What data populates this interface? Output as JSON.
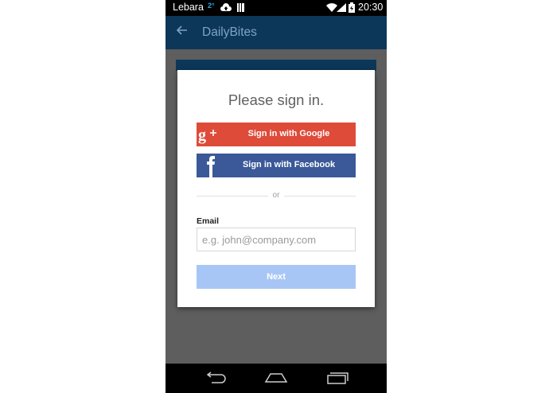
{
  "status_bar": {
    "carrier": "Lebara",
    "temperature": "2°",
    "time": "20:30"
  },
  "app_bar": {
    "title": "DailyBites",
    "back_icon": "arrow-left-icon",
    "color": "#0c3759"
  },
  "dialog": {
    "title": "Please sign in.",
    "google_button": {
      "label": "Sign in with Google",
      "icon": "google-plus-icon",
      "color": "#de4b39"
    },
    "facebook_button": {
      "label": "Sign in with Facebook",
      "icon": "facebook-icon",
      "color": "#3b5999"
    },
    "divider_text": "or",
    "email": {
      "label": "Email",
      "placeholder": "e.g. john@company.com",
      "value": ""
    },
    "next_button": {
      "label": "Next",
      "color": "#a8c6f5"
    }
  },
  "nav_bar": {
    "icons": [
      "back-nav-icon",
      "home-nav-icon",
      "recents-nav-icon"
    ]
  }
}
